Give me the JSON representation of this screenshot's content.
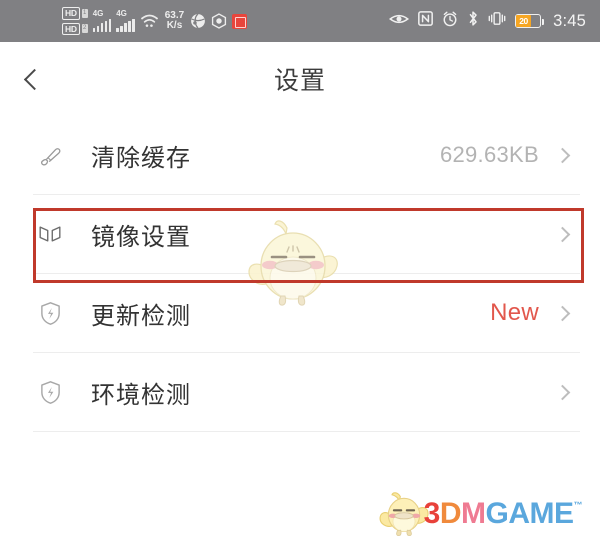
{
  "status_bar": {
    "hd_badge_1": "HD",
    "hd_badge_2": "HD",
    "sim_1": "1",
    "sim_2": "2",
    "network_1": "4G",
    "network_2": "4G",
    "wifi_icon": "wifi-icon",
    "speed_value": "63.7",
    "speed_unit": "K/s",
    "globe_icon": "globe-icon",
    "hexagon_icon": "hexagon-icon",
    "red_app_icon": "red-square-icon",
    "eye_icon": "eye-icon",
    "nfc_icon": "nfc-icon",
    "alarm_icon": "alarm-clock-icon",
    "bluetooth_icon": "bluetooth-icon",
    "vibrate_icon": "vibrate-icon",
    "battery_level": "20",
    "time": "3:45",
    "background_color": "#808083"
  },
  "header": {
    "back_icon": "back-chevron-icon",
    "title": "设置"
  },
  "list": {
    "rows": [
      {
        "icon": "brush-icon",
        "label": "清除缓存",
        "value": "629.63KB",
        "chevron": "chevron-right-icon",
        "highlighted": "false"
      },
      {
        "icon": "mirror-book-icon",
        "label": "镜像设置",
        "value": "",
        "chevron": "chevron-right-icon",
        "highlighted": "true"
      },
      {
        "icon": "shield-icon",
        "label": "更新检测",
        "value": "New",
        "chevron": "chevron-right-icon",
        "highlighted": "false"
      },
      {
        "icon": "shield-icon",
        "label": "环境检测",
        "value": "",
        "chevron": "chevron-right-icon",
        "highlighted": "false"
      }
    ]
  },
  "highlight": {
    "color": "#c0392b"
  },
  "watermark": {
    "mascot": "chick-mascot-watermark"
  },
  "footer_logo": {
    "mascot": "chick-mascot-icon",
    "part_3": "3",
    "part_d": "D",
    "part_m": "M",
    "part_game": "GAME",
    "trademark": "™",
    "color_3": "#e8413a",
    "color_d": "#f08a3c",
    "color_m": "#ef7b92",
    "color_game": "#5aa7dd"
  }
}
